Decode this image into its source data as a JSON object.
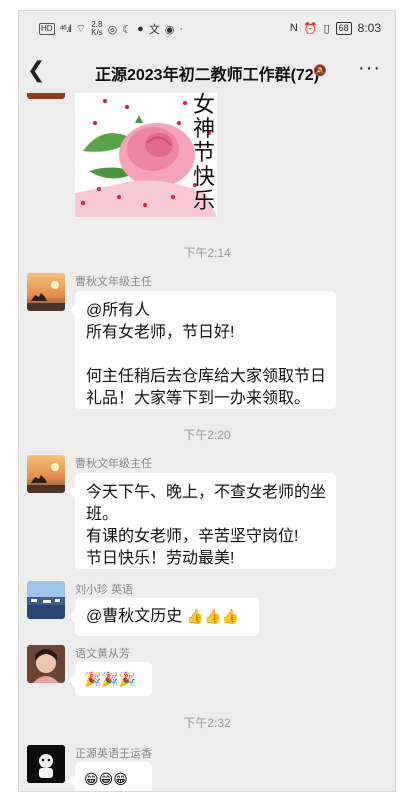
{
  "status_bar": {
    "left": {
      "hd": "HD",
      "signal": "⁴⁶.ıl",
      "speed_value": "2.8",
      "speed_unit": "K/s"
    },
    "right": {
      "nfc": "N",
      "battery": "68",
      "time": "8:03"
    }
  },
  "header": {
    "title": "正源2023年初二教师工作群(72)"
  },
  "image_message": {
    "caption_chars": [
      "女",
      "神",
      "节",
      "快",
      "乐"
    ]
  },
  "timestamps": {
    "t1": "下午2:14",
    "t2": "下午2:20",
    "t3": "下午2:32"
  },
  "messages": [
    {
      "sender": "曹秋文年级主任",
      "lines": [
        "@所有人",
        "所有女老师，节日好!",
        "",
        "何主任稍后去仓库给大家领取节日",
        "礼品！大家等下到一办来领取。"
      ]
    },
    {
      "sender": "曹秋文年级主任",
      "lines": [
        "今天下午、晚上，不查女老师的坐",
        "班。",
        "有课的女老师，辛苦坚守岗位!",
        "节日快乐！劳动最美!"
      ]
    },
    {
      "sender": "刘小珍 英语",
      "text": "@曹秋文历史",
      "emoji": "👍👍👍"
    },
    {
      "sender": "语文黄从芳",
      "emoji": "🎉🎉🎉"
    },
    {
      "sender": "正源英语王运香",
      "emoji": "😁😁😁"
    }
  ],
  "colors": {
    "chat_bg": "#ededed",
    "bubble": "#ffffff",
    "meta_text": "#999999"
  }
}
